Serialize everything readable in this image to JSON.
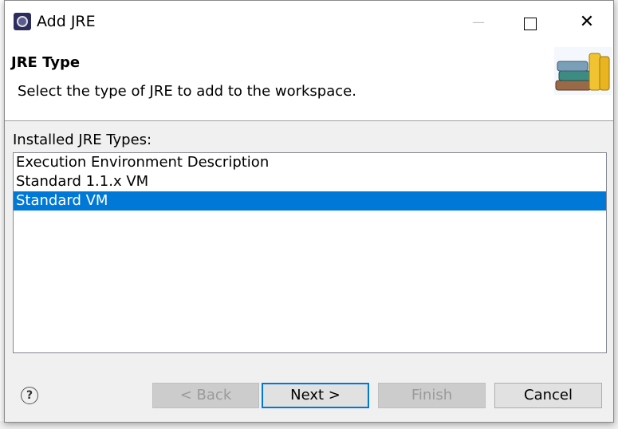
{
  "window": {
    "title": "Add JRE",
    "controls": {
      "minimize_icon": "minimize-icon",
      "maximize_icon": "maximize-icon",
      "close_icon": "close-icon"
    }
  },
  "header": {
    "title": "JRE Type",
    "description": "Select the type of JRE to add to the workspace.",
    "icon": "books-icon"
  },
  "list": {
    "label": "Installed JRE Types:",
    "items": [
      {
        "label": "Execution Environment Description",
        "selected": false
      },
      {
        "label": "Standard 1.1.x VM",
        "selected": false
      },
      {
        "label": "Standard VM",
        "selected": true
      }
    ]
  },
  "buttons": {
    "help_icon": "help-icon",
    "back": "< Back",
    "next": "Next >",
    "finish": "Finish",
    "cancel": "Cancel"
  },
  "colors": {
    "selection": "#0078d7",
    "dialog_bg": "#f0f0f0",
    "header_bg": "#ffffff"
  }
}
